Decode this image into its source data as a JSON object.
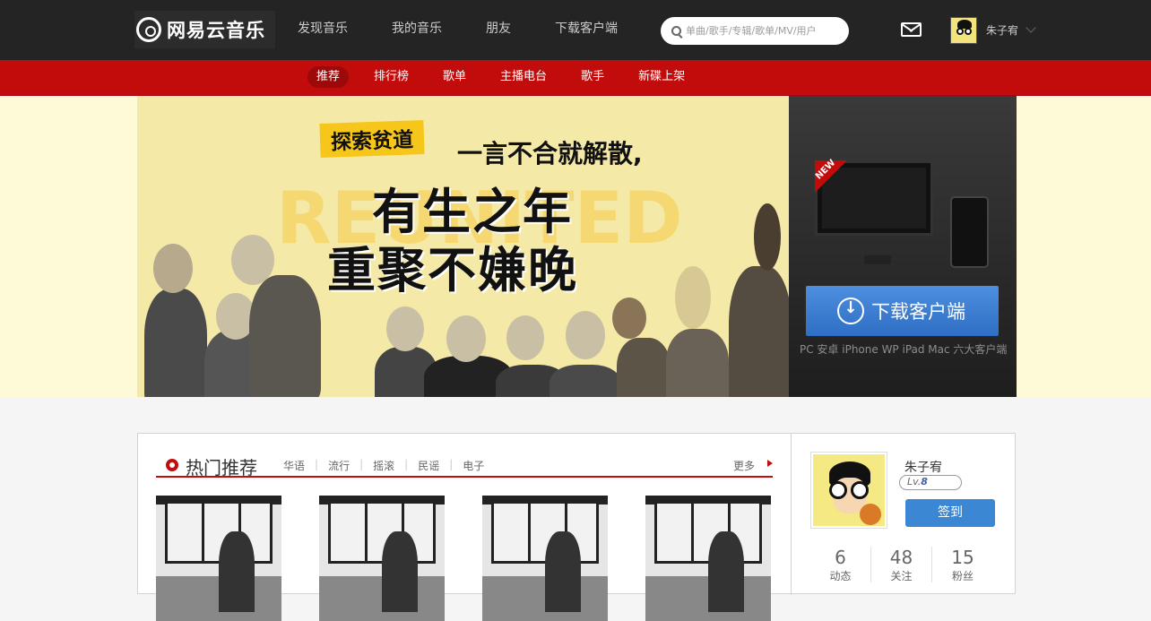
{
  "topbar": {
    "logo_text": "网易云音乐",
    "nav": [
      "发现音乐",
      "我的音乐",
      "朋友",
      "下载客户端"
    ],
    "search_placeholder": "单曲/歌手/专辑/歌单/MV/用户",
    "username": "朱子宥"
  },
  "subnav": {
    "items": [
      "推荐",
      "排行榜",
      "歌单",
      "主播电台",
      "歌手",
      "新碟上架"
    ],
    "active_index": 0
  },
  "banner": {
    "tag": "探索贫道",
    "subtitle": "一言不合就解散,",
    "line1": "有生之年",
    "line2": "重聚不嫌晚",
    "ghost_text": "REUNITED"
  },
  "download_panel": {
    "new_badge": "NEW",
    "button_label": "下载客户端",
    "caption": "PC 安卓 iPhone WP iPad Mac 六大客户端"
  },
  "hot": {
    "title": "热门推荐",
    "tabs": [
      "华语",
      "流行",
      "摇滚",
      "民谣",
      "电子"
    ],
    "more": "更多"
  },
  "profile": {
    "name": "朱子宥",
    "level_prefix": "Lv.",
    "level": "8",
    "checkin": "签到",
    "stats": [
      {
        "num": "6",
        "label": "动态"
      },
      {
        "num": "48",
        "label": "关注"
      },
      {
        "num": "15",
        "label": "粉丝"
      }
    ]
  },
  "colors": {
    "topbar": "#242424",
    "accent_red": "#c20c0c",
    "download_blue": "#3e7fd4"
  }
}
